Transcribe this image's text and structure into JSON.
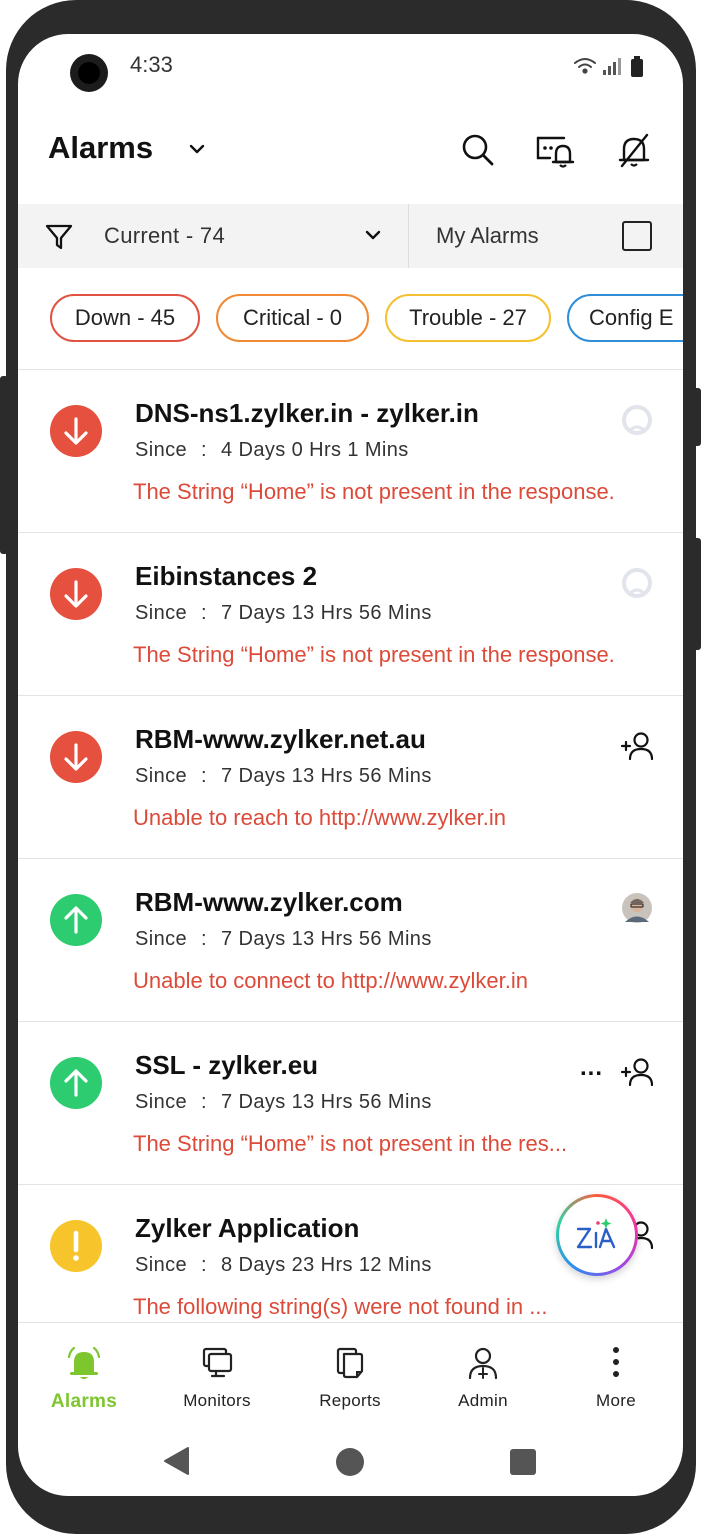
{
  "status_bar": {
    "time": "4:33"
  },
  "header": {
    "title": "Alarms"
  },
  "filter_bar": {
    "filter_label": "Current - 74",
    "my_alarms_label": "My Alarms"
  },
  "chips": [
    {
      "label": "Down - 45",
      "color": "#e25243"
    },
    {
      "label": "Critical - 0",
      "color": "#f08a34"
    },
    {
      "label": "Trouble - 27",
      "color": "#f4c130"
    },
    {
      "label": "Config E",
      "color": "#2f8ed5"
    }
  ],
  "alarms": [
    {
      "name": "DNS-ns1.zylker.in - zylker.in",
      "since_label": "Since",
      "separator": ":",
      "since_value": "4 Days 0 Hrs 1 Mins",
      "message": "The String “Home” is not present in the response.",
      "status": "down",
      "status_icon": "arrow-down-icon",
      "assignee": "unassigned-avatar-icon"
    },
    {
      "name": "Eibinstances 2",
      "since_label": "Since",
      "separator": ":",
      "since_value": "7 Days 13 Hrs 56 Mins",
      "message": "The String “Home” is not present in the response.",
      "status": "down",
      "status_icon": "arrow-down-icon",
      "assignee": "unassigned-avatar-icon"
    },
    {
      "name": "RBM-www.zylker.net.au",
      "since_label": "Since",
      "separator": ":",
      "since_value": "7 Days 13 Hrs 56 Mins",
      "message": "Unable to reach to http://www.zylker.in",
      "status": "down",
      "status_icon": "arrow-down-icon",
      "assignee": "assign-user-icon"
    },
    {
      "name": "RBM-www.zylker.com",
      "since_label": "Since",
      "separator": ":",
      "since_value": "7 Days 13 Hrs 56 Mins",
      "message": "Unable to connect to http://www.zylker.in",
      "status": "up",
      "status_icon": "arrow-up-icon",
      "assignee": "user-photo-avatar"
    },
    {
      "name": "SSL - zylker.eu",
      "since_label": "Since",
      "separator": ":",
      "since_value": "7 Days 13 Hrs 56 Mins",
      "message": "The String “Home” is not present in the res...",
      "status": "up",
      "status_icon": "arrow-up-icon",
      "assignee": "assign-user-icon",
      "more": "..."
    },
    {
      "name": "Zylker Application",
      "since_label": "Since",
      "separator": ":",
      "since_value": "8 Days 23 Hrs 12 Mins",
      "message": "The following string(s) were not found in ...",
      "status": "trouble",
      "status_icon": "exclamation-icon",
      "assignee": "assign-user-icon"
    }
  ],
  "colors": {
    "down": "#e5503f",
    "up": "#2ecc71",
    "trouble": "#f7c52b",
    "message": "#dc4a39",
    "active_nav": "#7dc62e"
  },
  "bottom_nav": [
    {
      "label": "Alarms",
      "icon": "bell-icon",
      "active": true
    },
    {
      "label": "Monitors",
      "icon": "monitor-icon",
      "active": false
    },
    {
      "label": "Reports",
      "icon": "reports-icon",
      "active": false
    },
    {
      "label": "Admin",
      "icon": "admin-icon",
      "active": false
    },
    {
      "label": "More",
      "icon": "more-vertical-icon",
      "active": false
    }
  ]
}
